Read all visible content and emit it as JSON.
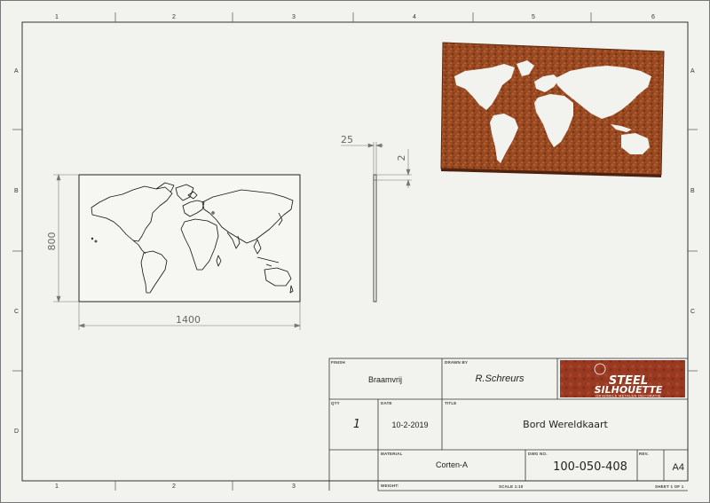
{
  "zones": {
    "top_columns": [
      "1",
      "2",
      "3",
      "4",
      "5",
      "6"
    ],
    "bottom_columns": [
      "1",
      "2",
      "3"
    ],
    "left_rows": [
      "A",
      "B",
      "C",
      "D"
    ],
    "right_rows": [
      "A",
      "B",
      "C"
    ]
  },
  "dimensions": {
    "height": "800",
    "width": "1400",
    "thickness": "2",
    "offset": "25"
  },
  "title_block": {
    "finish_label": "FINISH",
    "finish_value": "Braamvrij",
    "drawn_label": "DRAWN BY",
    "drawn_value": "R.Schreurs",
    "qty_label": "QTY",
    "qty_value": "1",
    "date_label": "DATE",
    "date_value": "10-2-2019",
    "title_label": "TITLE",
    "title_value": "Bord Wereldkaart",
    "material_label": "MATERIAL",
    "material_value": "Corten-A",
    "dwg_label": "DWG NO.",
    "dwg_value": "100-050-408",
    "rev_label": "REV.",
    "size_value": "A4",
    "weight_label": "WEIGHT:",
    "scale_label": "SCALE 1:10",
    "sheet_label": "SHEET 1 OF 1"
  },
  "logo": {
    "line1": "STEEL",
    "line2": "SILHOUETTE",
    "tagline": "ORIGINELE METALEN DECORATIE"
  },
  "colors": {
    "border": "#333333",
    "corten": "#a0522d",
    "corten_dark": "#6e2f12",
    "logo_bg": "#b23a2a"
  }
}
